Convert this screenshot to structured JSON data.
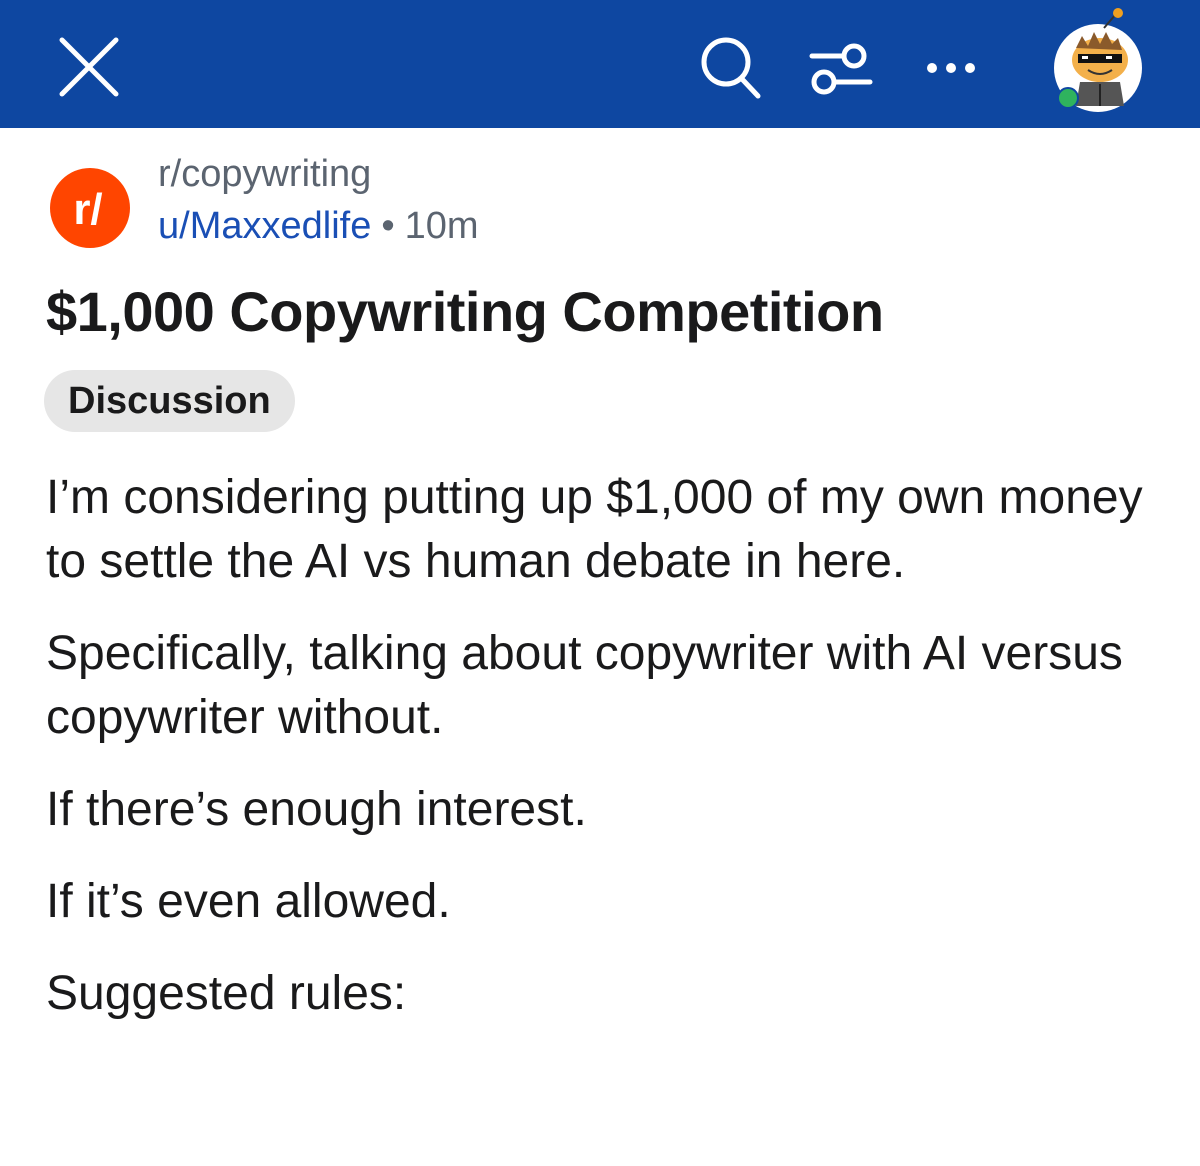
{
  "header": {
    "close_icon": "close-icon",
    "search_icon": "search-icon",
    "filter_icon": "filter-sliders-icon",
    "more_icon": "more-horizontal-icon",
    "avatar": "user-avatar",
    "background_color": "#0e47a1",
    "online_status_color": "#2fb35e"
  },
  "post": {
    "subreddit": "r/copywriting",
    "subreddit_logo_text": "r/",
    "author": "u/Maxxedlife",
    "separator": "•",
    "age": "10m",
    "title": "$1,000 Copywriting Competition",
    "flair": "Discussion",
    "paragraphs": [
      "I’m considering putting up $1,000 of my own money to settle the AI vs human debate in here.",
      "Specifically, talking about copywriter with AI versus copywriter without.",
      "If there’s enough interest.",
      "If it’s even allowed.",
      "Suggested rules:"
    ]
  },
  "colors": {
    "subreddit_logo": "#ff4500",
    "author_link": "#1a4fb5",
    "muted_text": "#5b6470",
    "flair_bg": "#e6e6e6"
  }
}
